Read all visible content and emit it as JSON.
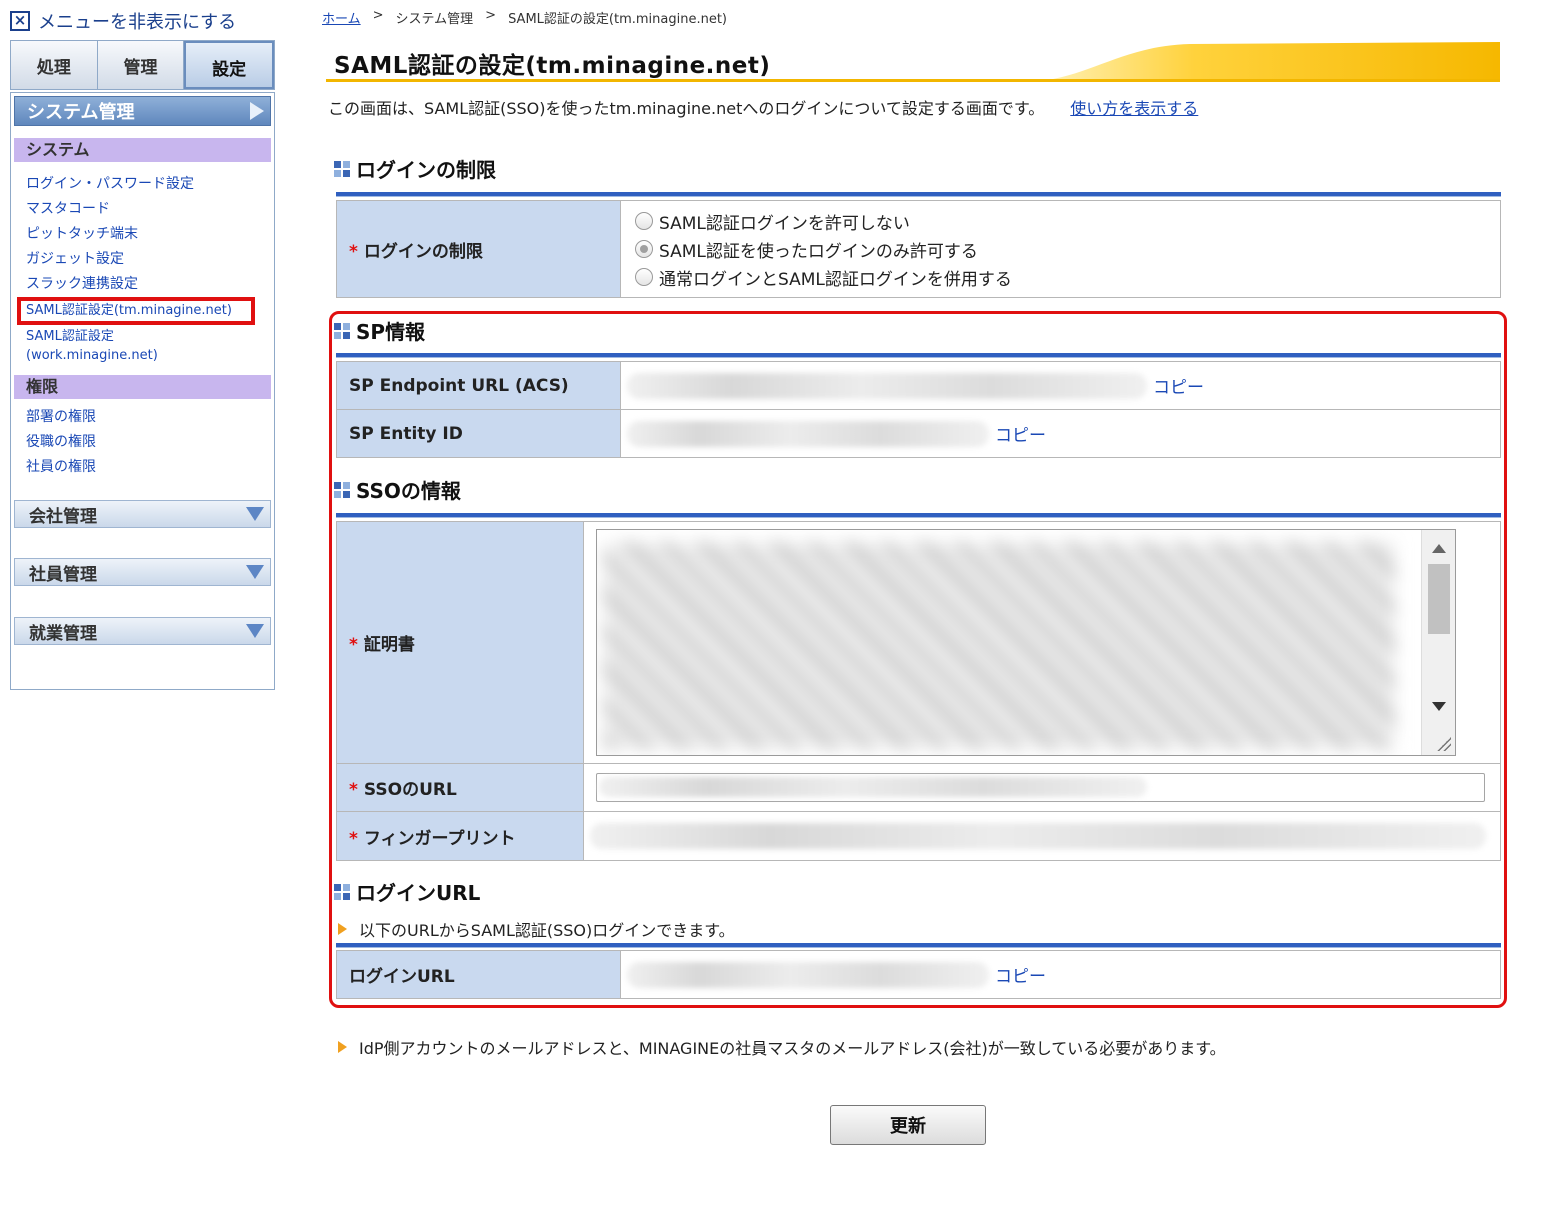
{
  "sidebar": {
    "toggle_label": "メニューを非表示にする",
    "tabs": [
      {
        "label": "処理"
      },
      {
        "label": "管理"
      },
      {
        "label": "設定"
      }
    ],
    "header": "システム管理",
    "section_system": "システム",
    "system_links": [
      {
        "label": "ログイン・パスワード設定"
      },
      {
        "label": "マスタコード"
      },
      {
        "label": "ピットタッチ端末"
      },
      {
        "label": "ガジェット設定"
      },
      {
        "label": "スラック連携設定"
      },
      {
        "label": "SAML認証設定(tm.minagine.net)"
      },
      {
        "label": "SAML認証設定\n(work.minagine.net)"
      }
    ],
    "section_auth": "権限",
    "auth_links": [
      {
        "label": "部署の権限"
      },
      {
        "label": "役職の権限"
      },
      {
        "label": "社員の権限"
      }
    ],
    "groups": [
      {
        "label": "会社管理"
      },
      {
        "label": "社員管理"
      },
      {
        "label": "就業管理"
      }
    ]
  },
  "breadcrumb": {
    "home": "ホーム",
    "sep": ">",
    "level1": "システム管理",
    "level2": "SAML認証の設定(tm.minagine.net)"
  },
  "page": {
    "title": "SAML認証の設定(tm.minagine.net)",
    "intro": "この画面は、SAML認証(SSO)を使ったtm.minagine.netへのログインについて設定する画面です。",
    "help_link": "使い方を表示する"
  },
  "login_restriction": {
    "heading": "ログインの制限",
    "label": "ログインの制限",
    "options": [
      {
        "label": "SAML認証ログインを許可しない",
        "checked": false
      },
      {
        "label": "SAML認証を使ったログインのみ許可する",
        "checked": true
      },
      {
        "label": "通常ログインとSAML認証ログインを併用する",
        "checked": false
      }
    ]
  },
  "sp_info": {
    "heading": "SP情報",
    "endpoint_label": "SP Endpoint URL (ACS)",
    "entity_label": "SP Entity ID",
    "copy_label": "コピー"
  },
  "sso_info": {
    "heading": "SSOの情報",
    "cert_label": "証明書",
    "url_label": "SSOのURL",
    "fingerprint_label": "フィンガープリント"
  },
  "login_url": {
    "heading": "ログインURL",
    "note": "以下のURLからSAML認証(SSO)ログインできます。",
    "label": "ログインURL",
    "copy_label": "コピー"
  },
  "footer_note": "IdP側アカウントのメールアドレスと、MINAGINEの社員マスタのメールアドレス(会社)が一致している必要があります。",
  "update_button": "更新",
  "required_mark": "*",
  "colors": {
    "accent_blue": "#2f5fc0",
    "header_cell": "#c9d9ef",
    "highlight_red": "#e01010",
    "title_gold": "#f2b600"
  }
}
